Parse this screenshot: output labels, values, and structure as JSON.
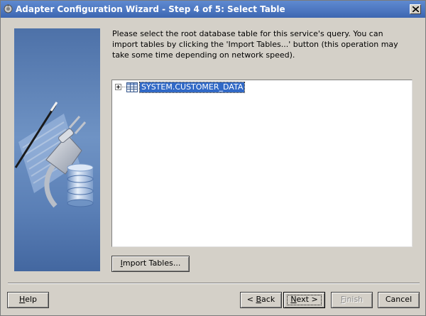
{
  "window": {
    "title": "Adapter Configuration Wizard - Step 4 of 5: Select Table"
  },
  "instructions": "Please select the root database table for this service's query.  You can import tables by clicking the 'Import Tables...' button (this operation may take some time depending on network speed).",
  "tree": {
    "nodes": [
      {
        "label": "SYSTEM.CUSTOMER_DATA",
        "expanded": false,
        "selected": true,
        "icon": "database-table-icon"
      }
    ]
  },
  "buttons": {
    "import_tables": {
      "pre": "",
      "mnemonic": "I",
      "post": "mport Tables..."
    },
    "help": {
      "pre": "",
      "mnemonic": "H",
      "post": "elp"
    },
    "back": {
      "pre": "< ",
      "mnemonic": "B",
      "post": "ack"
    },
    "next": {
      "pre": "",
      "mnemonic": "N",
      "post": "ext >"
    },
    "finish": {
      "pre": "",
      "mnemonic": "F",
      "post": "inish"
    },
    "cancel": {
      "pre": "Cancel",
      "mnemonic": "",
      "post": ""
    }
  },
  "colors": {
    "title_bar": "#4b75bf",
    "selection": "#3169c6",
    "dialog_bg": "#d4d0c8"
  }
}
